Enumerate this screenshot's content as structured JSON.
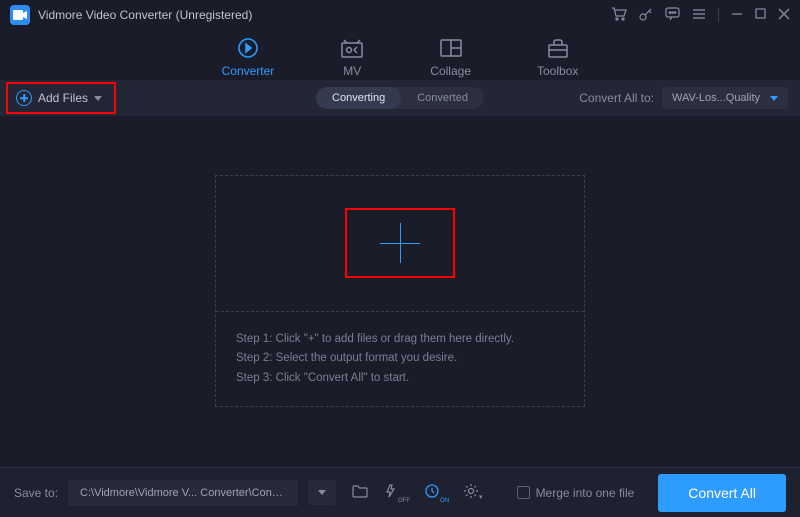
{
  "window": {
    "title": "Vidmore Video Converter (Unregistered)"
  },
  "tabs": {
    "converter": "Converter",
    "mv": "MV",
    "collage": "Collage",
    "toolbox": "Toolbox"
  },
  "toolbar": {
    "add_files": "Add Files",
    "mode_converting": "Converting",
    "mode_converted": "Converted",
    "convert_all_to_label": "Convert All to:",
    "format_selected": "WAV-Los...Quality"
  },
  "dropzone": {
    "step1": "Step 1: Click \"+\" to add files or drag them here directly.",
    "step2": "Step 2: Select the output format you desire.",
    "step3": "Step 3: Click \"Convert All\" to start."
  },
  "bottombar": {
    "save_to_label": "Save to:",
    "save_path": "C:\\Vidmore\\Vidmore V... Converter\\Converted",
    "merge_label": "Merge into one file",
    "convert_all_button": "Convert All"
  }
}
